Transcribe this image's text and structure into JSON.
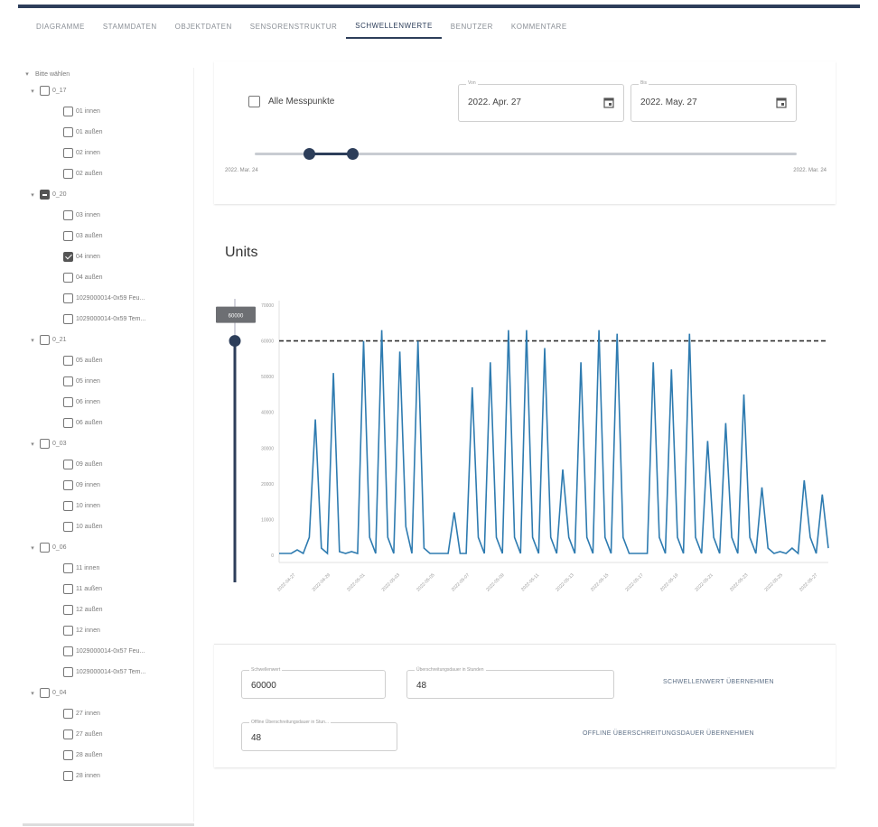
{
  "nav": {
    "tabs": [
      {
        "label": "Diagramme",
        "active": false
      },
      {
        "label": "Stammdaten",
        "active": false
      },
      {
        "label": "Objektdaten",
        "active": false
      },
      {
        "label": "Sensorenstruktur",
        "active": false
      },
      {
        "label": "Schwellenwerte",
        "active": true
      },
      {
        "label": "Benutzer",
        "active": false
      },
      {
        "label": "Kommentare",
        "active": false
      }
    ]
  },
  "sidebar": {
    "root_label": "Bitte wählen",
    "groups": [
      {
        "label": "0_17",
        "state": "unchecked",
        "items": [
          {
            "label": "01 innen",
            "checked": false
          },
          {
            "label": "01 außen",
            "checked": false
          },
          {
            "label": "02 innen",
            "checked": false
          },
          {
            "label": "02 außen",
            "checked": false
          }
        ]
      },
      {
        "label": "0_20",
        "state": "partial",
        "items": [
          {
            "label": "03 innen",
            "checked": false
          },
          {
            "label": "03 außen",
            "checked": false
          },
          {
            "label": "04 innen",
            "checked": true
          },
          {
            "label": "04 außen",
            "checked": false
          },
          {
            "label": "1029000014-0x59 Feu...",
            "checked": false
          },
          {
            "label": "1029000014-0x59 Tem...",
            "checked": false
          }
        ]
      },
      {
        "label": "0_21",
        "state": "unchecked",
        "items": [
          {
            "label": "05 außen",
            "checked": false
          },
          {
            "label": "05 innen",
            "checked": false
          },
          {
            "label": "06 innen",
            "checked": false
          },
          {
            "label": "06 außen",
            "checked": false
          }
        ]
      },
      {
        "label": "0_03",
        "state": "unchecked",
        "items": [
          {
            "label": "09 außen",
            "checked": false
          },
          {
            "label": "09 innen",
            "checked": false
          },
          {
            "label": "10 innen",
            "checked": false
          },
          {
            "label": "10 außen",
            "checked": false
          }
        ]
      },
      {
        "label": "0_06",
        "state": "unchecked",
        "items": [
          {
            "label": "11 innen",
            "checked": false
          },
          {
            "label": "11 außen",
            "checked": false
          },
          {
            "label": "12 außen",
            "checked": false
          },
          {
            "label": "12 innen",
            "checked": false
          },
          {
            "label": "1029000014-0x57 Feu...",
            "checked": false
          },
          {
            "label": "1029000014-0x57 Tem...",
            "checked": false
          }
        ]
      },
      {
        "label": "0_04",
        "state": "unchecked",
        "items": [
          {
            "label": "27 innen",
            "checked": false
          },
          {
            "label": "27 außen",
            "checked": false
          },
          {
            "label": "28 außen",
            "checked": false
          },
          {
            "label": "28 innen",
            "checked": false
          }
        ]
      }
    ]
  },
  "filter": {
    "all_points_label": "Alle Messpunkte",
    "from_label": "Von",
    "from_value": "2022. Apr. 27",
    "to_label": "Bis",
    "to_value": "2022. May. 27",
    "range_start_label": "2022. Mar. 24",
    "range_end_label": "2022. Mar. 24",
    "range_start_fraction": 0.1,
    "range_end_fraction": 0.18
  },
  "chart_title": "Units",
  "chart_data": {
    "type": "line",
    "ylim": [
      0,
      70000
    ],
    "yticks": [
      0,
      10000,
      20000,
      30000,
      40000,
      50000,
      60000,
      70000
    ],
    "threshold": 60000,
    "threshold_label": "60000",
    "xticks": [
      "2022-04-27",
      "2022-04-29",
      "2022-05-01",
      "2022-05-03",
      "2022-05-05",
      "2022-05-07",
      "2022-05-09",
      "2022-05-11",
      "2022-05-13",
      "2022-05-15",
      "2022-05-17",
      "2022-05-19",
      "2022-05-21",
      "2022-05-23",
      "2022-05-25",
      "2022-05-27"
    ],
    "series": [
      {
        "color": "#2e7bb0",
        "values": [
          500,
          500,
          500,
          1500,
          500,
          5000,
          38000,
          2000,
          500,
          51000,
          1000,
          500,
          1000,
          500,
          60000,
          5000,
          500,
          63000,
          5000,
          500,
          57000,
          8000,
          500,
          60000,
          2000,
          500,
          500,
          500,
          500,
          12000,
          500,
          500,
          47000,
          5000,
          500,
          54000,
          5000,
          500,
          63000,
          5000,
          500,
          63000,
          5000,
          500,
          58000,
          5000,
          500,
          24000,
          5000,
          500,
          54000,
          5000,
          500,
          63000,
          5000,
          500,
          62000,
          5000,
          500,
          500,
          500,
          500,
          54000,
          5000,
          500,
          52000,
          5000,
          500,
          62000,
          5000,
          500,
          32000,
          5000,
          500,
          37000,
          5000,
          500,
          45000,
          5000,
          500,
          19000,
          2000,
          500,
          1000,
          500,
          2000,
          500,
          21000,
          5000,
          500,
          17000,
          2000
        ]
      }
    ]
  },
  "settings": {
    "threshold_label": "Schwellenwert",
    "threshold_value": "60000",
    "duration_label": "Überschreitungsdauer in Stunden",
    "duration_value": "48",
    "apply_threshold": "Schwellenwert übernehmen",
    "offline_label": "Offline Überschreitungsdauer in Stun...",
    "offline_value": "48",
    "apply_offline": "Offline Überschreitungsdauer übernehmen"
  }
}
